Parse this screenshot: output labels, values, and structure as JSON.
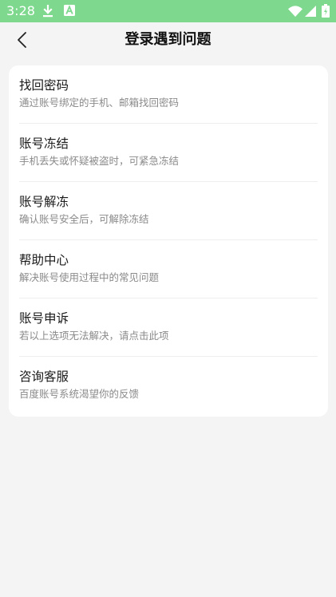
{
  "status_bar": {
    "time": "3:28",
    "icons": [
      "download-icon",
      "a-icon",
      "wifi-icon",
      "signal-icon",
      "battery-icon"
    ],
    "background": "#7ed98f"
  },
  "header": {
    "title": "登录遇到问题",
    "back_icon": "chevron-left-icon"
  },
  "menu": {
    "items": [
      {
        "title": "找回密码",
        "description": "通过账号绑定的手机、邮箱找回密码"
      },
      {
        "title": "账号冻结",
        "description": "手机丢失或怀疑被盗时，可紧急冻结"
      },
      {
        "title": "账号解冻",
        "description": "确认账号安全后，可解除冻结"
      },
      {
        "title": "帮助中心",
        "description": "解决账号使用过程中的常见问题"
      },
      {
        "title": "账号申诉",
        "description": "若以上选项无法解决，请点击此项"
      },
      {
        "title": "咨询客服",
        "description": "百度账号系统渴望你的反馈"
      }
    ]
  },
  "colors": {
    "page_background": "#f4f4f4",
    "card_background": "#ffffff",
    "title_text": "#1a1a1a",
    "description_text": "#8a8a8a"
  }
}
